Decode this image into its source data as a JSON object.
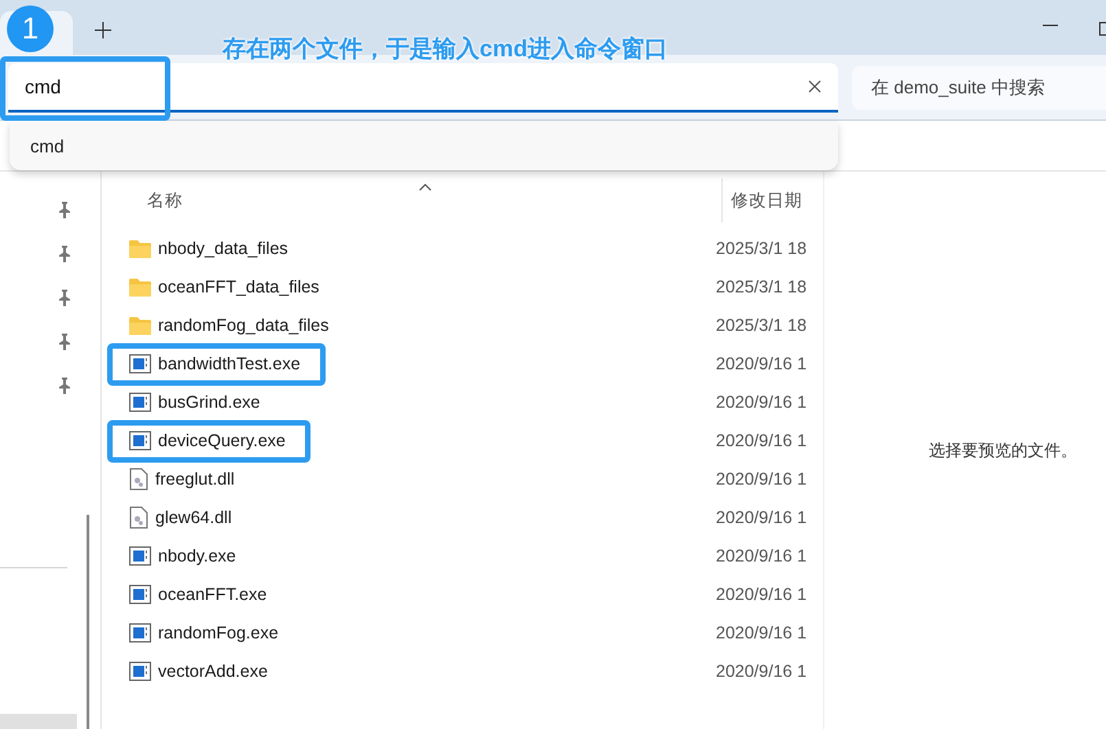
{
  "annotation": {
    "step": "1",
    "note": "存在两个文件，于是输入cmd进入命令窗口"
  },
  "address_bar": {
    "value": "cmd",
    "highlighted": true
  },
  "suggestions": [
    {
      "label": "cmd"
    }
  ],
  "search": {
    "placeholder": "在 demo_suite 中搜索"
  },
  "columns": [
    "名称",
    "修改日期"
  ],
  "files": [
    {
      "name": "nbody_data_files",
      "kind": "folder",
      "modified": "2025/3/1 18",
      "highlighted": false
    },
    {
      "name": "oceanFFT_data_files",
      "kind": "folder",
      "modified": "2025/3/1 18",
      "highlighted": false
    },
    {
      "name": "randomFog_data_files",
      "kind": "folder",
      "modified": "2025/3/1 18",
      "highlighted": false
    },
    {
      "name": "bandwidthTest.exe",
      "kind": "exe",
      "modified": "2020/9/16 1",
      "highlighted": true
    },
    {
      "name": "busGrind.exe",
      "kind": "exe",
      "modified": "2020/9/16 1",
      "highlighted": false
    },
    {
      "name": "deviceQuery.exe",
      "kind": "exe",
      "modified": "2020/9/16 1",
      "highlighted": true
    },
    {
      "name": "freeglut.dll",
      "kind": "dll",
      "modified": "2020/9/16 1",
      "highlighted": false
    },
    {
      "name": "glew64.dll",
      "kind": "dll",
      "modified": "2020/9/16 1",
      "highlighted": false
    },
    {
      "name": "nbody.exe",
      "kind": "exe",
      "modified": "2020/9/16 1",
      "highlighted": false
    },
    {
      "name": "oceanFFT.exe",
      "kind": "exe",
      "modified": "2020/9/16 1",
      "highlighted": false
    },
    {
      "name": "randomFog.exe",
      "kind": "exe",
      "modified": "2020/9/16 1",
      "highlighted": false
    },
    {
      "name": "vectorAdd.exe",
      "kind": "exe",
      "modified": "2020/9/16 1",
      "highlighted": false
    }
  ],
  "preview": {
    "message": "选择要预览的文件。"
  }
}
